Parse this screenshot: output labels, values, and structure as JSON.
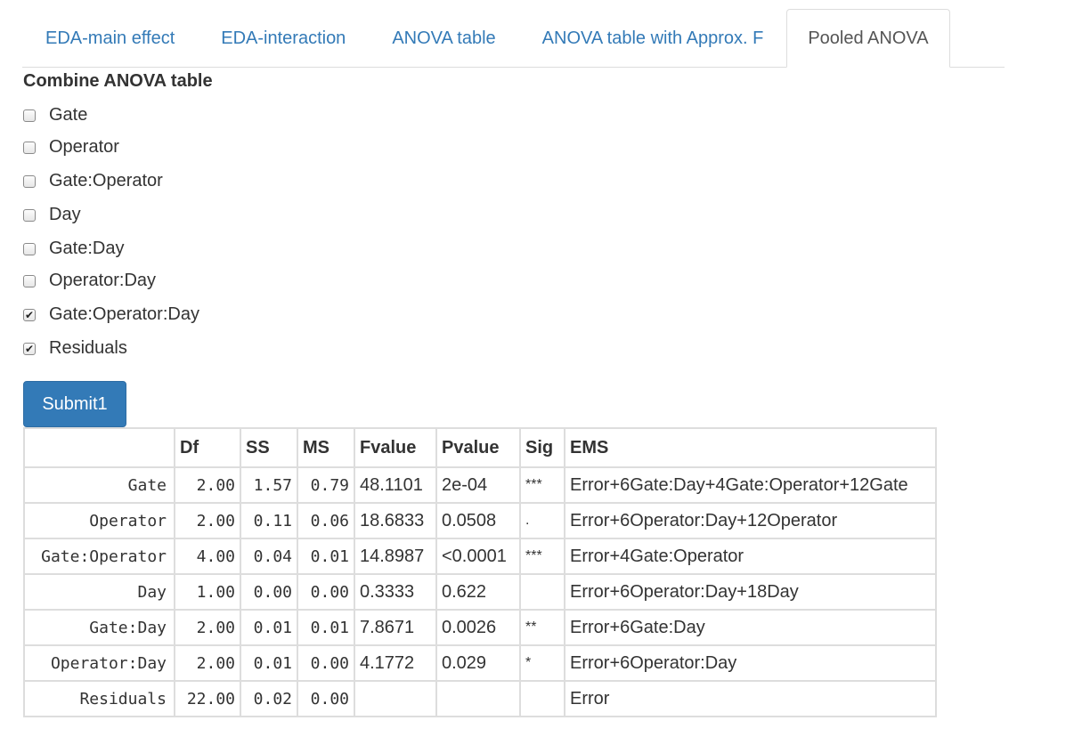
{
  "tabs": [
    {
      "label": "EDA-main effect",
      "active": false
    },
    {
      "label": "EDA-interaction",
      "active": false
    },
    {
      "label": "ANOVA table",
      "active": false
    },
    {
      "label": "ANOVA table with Approx. F",
      "active": false
    },
    {
      "label": "Pooled ANOVA",
      "active": true
    }
  ],
  "form": {
    "title": "Combine ANOVA table",
    "options": [
      {
        "label": "Gate",
        "checked": false
      },
      {
        "label": "Operator",
        "checked": false
      },
      {
        "label": "Gate:Operator",
        "checked": false
      },
      {
        "label": "Day",
        "checked": false
      },
      {
        "label": "Gate:Day",
        "checked": false
      },
      {
        "label": "Operator:Day",
        "checked": false
      },
      {
        "label": "Gate:Operator:Day",
        "checked": true
      },
      {
        "label": "Residuals",
        "checked": true
      }
    ],
    "submit_label": "Submit1"
  },
  "table": {
    "headers": [
      "",
      "Df",
      "SS",
      "MS",
      "Fvalue",
      "Pvalue",
      "Sig",
      "EMS"
    ],
    "rows": [
      [
        "Gate",
        "2.00",
        "1.57",
        "0.79",
        "48.1101",
        "2e-04",
        "***",
        "Error+6Gate:Day+4Gate:Operator+12Gate"
      ],
      [
        "Operator",
        "2.00",
        "0.11",
        "0.06",
        "18.6833",
        "0.0508",
        ".",
        "Error+6Operator:Day+12Operator"
      ],
      [
        "Gate:Operator",
        "4.00",
        "0.04",
        "0.01",
        "14.8987",
        "<0.0001",
        "***",
        "Error+4Gate:Operator"
      ],
      [
        "Day",
        "1.00",
        "0.00",
        "0.00",
        "0.3333",
        "0.622",
        "",
        "Error+6Operator:Day+18Day"
      ],
      [
        "Gate:Day",
        "2.00",
        "0.01",
        "0.01",
        "7.8671",
        "0.0026",
        "**",
        "Error+6Gate:Day"
      ],
      [
        "Operator:Day",
        "2.00",
        "0.01",
        "0.00",
        "4.1772",
        "0.029",
        "*",
        "Error+6Operator:Day"
      ],
      [
        "Residuals",
        "22.00",
        "0.02",
        "0.00",
        "",
        "",
        "",
        "Error"
      ]
    ]
  },
  "colors": {
    "link": "#337ab7",
    "button_bg": "#337ab7",
    "border": "#dddddd"
  }
}
